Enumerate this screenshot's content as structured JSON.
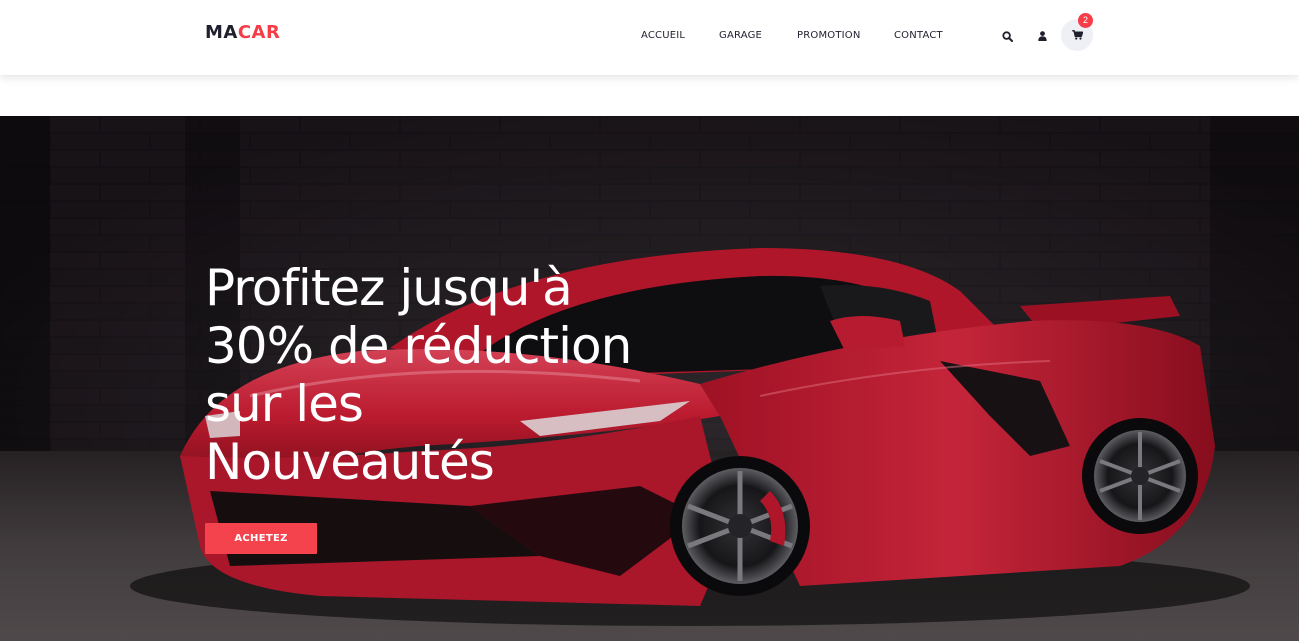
{
  "brand": {
    "part1": "MA",
    "part2": "CAR"
  },
  "nav": {
    "items": [
      {
        "label": "ACCUEIL"
      },
      {
        "label": "GARAGE"
      },
      {
        "label": "PROMOTION"
      },
      {
        "label": "CONTACT"
      }
    ]
  },
  "actions": {
    "search_icon": "search-icon",
    "user_icon": "user-icon",
    "cart_icon": "cart-icon",
    "cart_count": "2"
  },
  "hero": {
    "title_lines": [
      "Profitez jusqu'à",
      "30% de réduction",
      "sur les",
      "Nouveautés"
    ],
    "cta_label": "ACHETEZ"
  },
  "colors": {
    "accent": "#f53d48",
    "dark": "#1f1f2e",
    "hero_bg": "#141014",
    "car_red": "#d61f36"
  }
}
